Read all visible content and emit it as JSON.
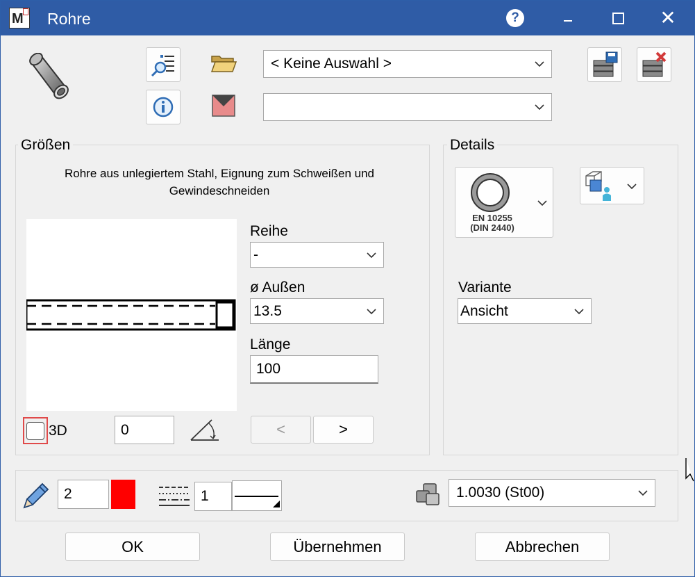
{
  "window": {
    "title": "Rohre",
    "app_icon_letter": "M"
  },
  "titlebar": {
    "help_glyph": "?",
    "close_glyph": "✕"
  },
  "top": {
    "selection_combo": "< Keine Auswahl >",
    "second_combo": ""
  },
  "sizes": {
    "group_label": "Größen",
    "description": "Rohre aus unlegiertem Stahl, Eignung zum Schweißen und Gewindeschneiden",
    "reihe_label": "Reihe",
    "reihe_value": "-",
    "aussen_label": "ø Außen",
    "aussen_value": "13.5",
    "laenge_label": "Länge",
    "laenge_value": "100",
    "checkbox_3d_label": "3D",
    "angle_value": "0",
    "prev_label": "<",
    "next_label": ">"
  },
  "details": {
    "group_label": "Details",
    "norm_line1": "EN 10255",
    "norm_line2": "(DIN 2440)",
    "variante_label": "Variante",
    "variante_value": "Ansicht"
  },
  "bottom": {
    "pen_value": "2",
    "pen_color": "#ff0000",
    "line_value": "1",
    "material_value": "1.0030 (St00)"
  },
  "buttons": {
    "ok": "OK",
    "apply": "Übernehmen",
    "cancel": "Abbrechen"
  },
  "colors": {
    "titlebar": "#2f5ca6",
    "highlight_border": "#e04a4a"
  }
}
